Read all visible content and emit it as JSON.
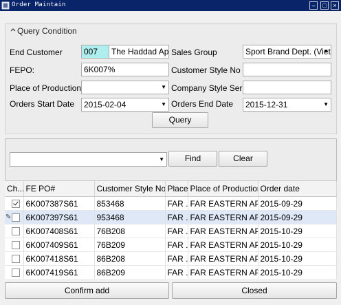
{
  "window": {
    "title": "Order Maintain",
    "colors": {
      "titlebar": "#0a246a",
      "highlight_cell": "#aeeeee",
      "selected_row": "#dfe8f6"
    }
  },
  "query": {
    "header": "Query Condition",
    "end_customer_label": "End Customer",
    "end_customer_code": "007",
    "end_customer_name": "The Haddad Apparel",
    "sales_group_label": "Sales Group",
    "sales_group_value": "Sport Brand Dept. (Vietna",
    "fepo_label": "FEPO:",
    "fepo_value": "6K007%",
    "customer_style_label": "Customer Style No",
    "customer_style_value": "",
    "place_label": "Place of Production",
    "place_value": "",
    "company_style_label": "Company Style Serial NO",
    "company_style_value": "",
    "start_date_label": "Orders Start Date",
    "start_date_value": "2015-02-04",
    "end_date_label": "Orders End Date",
    "end_date_value": "2015-12-31",
    "query_button": "Query"
  },
  "filter": {
    "value": "",
    "find_button": "Find",
    "clear_button": "Clear"
  },
  "grid": {
    "columns": [
      "Ch...",
      "FE PO#",
      "Customer Style No",
      "Place...",
      "Place of Production",
      "Order date"
    ],
    "rows": [
      {
        "checked": true,
        "po": "6K007387S61",
        "style": "853468",
        "place_short": "FAR ...",
        "place": "FAR EASTERN APPARE...",
        "date": "2015-09-29"
      },
      {
        "checked": false,
        "po": "6K007397S61",
        "style": "953468",
        "place_short": "FAR ...",
        "place": "FAR EASTERN APPARE...",
        "date": "2015-09-29",
        "selected": true
      },
      {
        "checked": false,
        "po": "6K007408S61",
        "style": "76B208",
        "place_short": "FAR ...",
        "place": "FAR EASTERN APPARE...",
        "date": "2015-10-29"
      },
      {
        "checked": false,
        "po": "6K007409S61",
        "style": "76B209",
        "place_short": "FAR ...",
        "place": "FAR EASTERN APPARE...",
        "date": "2015-10-29"
      },
      {
        "checked": false,
        "po": "6K007418S61",
        "style": "86B208",
        "place_short": "FAR ...",
        "place": "FAR EASTERN APPARE...",
        "date": "2015-10-29"
      },
      {
        "checked": false,
        "po": "6K007419S61",
        "style": "86B209",
        "place_short": "FAR ...",
        "place": "FAR EASTERN APPARE...",
        "date": "2015-10-29"
      }
    ]
  },
  "footer": {
    "confirm_button": "Confirm add",
    "closed_button": "Closed"
  }
}
